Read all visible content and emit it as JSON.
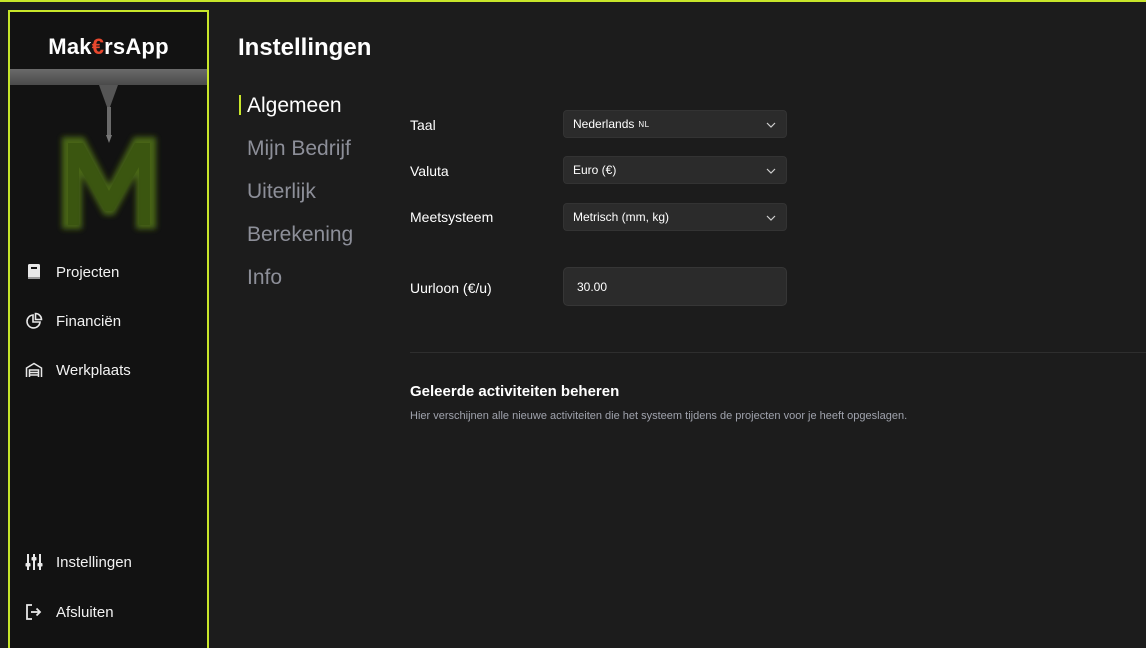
{
  "app": {
    "brand_pre": "Mak",
    "brand_euro": "€",
    "brand_post": "rsApp",
    "accent_color": "#c8e62a",
    "brand_accent_color": "#e8482e"
  },
  "sidebar": {
    "items": [
      {
        "label": "Projecten",
        "icon": "book-icon"
      },
      {
        "label": "Financiën",
        "icon": "pie-chart-icon"
      },
      {
        "label": "Werkplaats",
        "icon": "warehouse-icon"
      }
    ],
    "bottom_items": [
      {
        "label": "Instellingen",
        "icon": "sliders-icon"
      },
      {
        "label": "Afsluiten",
        "icon": "logout-icon"
      }
    ]
  },
  "page": {
    "title": "Instellingen"
  },
  "subnav": {
    "items": [
      "Algemeen",
      "Mijn Bedrijf",
      "Uiterlijk",
      "Berekening",
      "Info"
    ],
    "active": "Algemeen"
  },
  "settings": {
    "taal": {
      "label": "Taal",
      "value": "Nederlands",
      "code": "NL"
    },
    "valuta": {
      "label": "Valuta",
      "value": "Euro (€)"
    },
    "meetsysteem": {
      "label": "Meetsysteem",
      "value": "Metrisch (mm, kg)"
    },
    "uurloon": {
      "label": "Uurloon (€/u)",
      "value": "30.00"
    }
  },
  "activities": {
    "title": "Geleerde activiteiten beheren",
    "description": "Hier verschijnen alle nieuwe activiteiten die het systeem tijdens de projecten voor je heeft opgeslagen."
  }
}
